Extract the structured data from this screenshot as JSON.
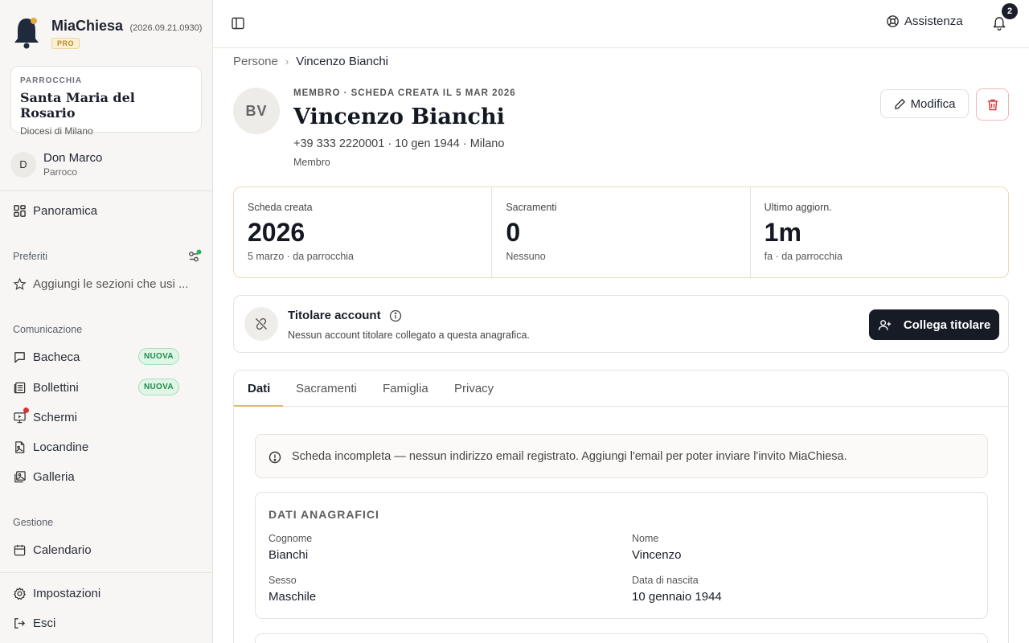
{
  "brand": {
    "name": "MiaChiesa",
    "version": "(2026.09.21.0930)",
    "badge": "PRO"
  },
  "parish": {
    "kicker": "PARROCCHIA",
    "name": "Santa Maria del Rosario",
    "diocese": "Diocesi di Milano"
  },
  "user": {
    "initial": "D",
    "name": "Don Marco",
    "role": "Parroco"
  },
  "nav": {
    "overview": "Panoramica",
    "favorites_label": "Preferiti",
    "favorites_add": "Aggiungi le sezioni che usi ...",
    "communication_label": "Comunicazione",
    "bacheca": "Bacheca",
    "bollettini": "Bollettini",
    "schermi": "Schermi",
    "locandine": "Locandine",
    "galleria": "Galleria",
    "new_badge": "NUOVA",
    "management_label": "Gestione",
    "calendario": "Calendario",
    "settings": "Impostazioni",
    "logout": "Esci"
  },
  "topbar": {
    "help": "Assistenza",
    "notifications_count": "2"
  },
  "breadcrumb": {
    "parent": "Persone",
    "sep": "›",
    "current": "Vincenzo Bianchi"
  },
  "person": {
    "initials": "BV",
    "kicker": "MEMBRO · SCHEDA CREATA IL 5 MAR 2026",
    "name": "Vincenzo Bianchi",
    "meta": "+39 333 2220001 · 10 gen 1944 · Milano",
    "role": "Membro"
  },
  "actions": {
    "edit": "Modifica"
  },
  "stats": [
    {
      "label": "Scheda creata",
      "value": "2026",
      "sub": "5 marzo · da parrocchia"
    },
    {
      "label": "Sacramenti",
      "value": "0",
      "sub": "Nessuno"
    },
    {
      "label": "Ultimo aggiorn.",
      "value": "1m",
      "sub": "fa · da parrocchia"
    }
  ],
  "account": {
    "title": "Titolare account",
    "desc": "Nessun account titolare collegato a questa anagrafica.",
    "button": "Collega titolare"
  },
  "tabs": [
    "Dati",
    "Sacramenti",
    "Famiglia",
    "Privacy"
  ],
  "alert": "Scheda incompleta — nessun indirizzo email registrato. Aggiungi l'email per poter inviare l'invito MiaChiesa.",
  "anagrafica": {
    "title": "DATI ANAGRAFICI",
    "fields": [
      {
        "label": "Cognome",
        "value": "Bianchi"
      },
      {
        "label": "Nome",
        "value": "Vincenzo"
      },
      {
        "label": "Sesso",
        "value": "Maschile"
      },
      {
        "label": "Data di nascita",
        "value": "10 gennaio 1944"
      }
    ]
  },
  "colors": {
    "accent": "#e2b86a",
    "dark": "#161b26",
    "green": "#1f8a4a",
    "red": "#e03131"
  }
}
